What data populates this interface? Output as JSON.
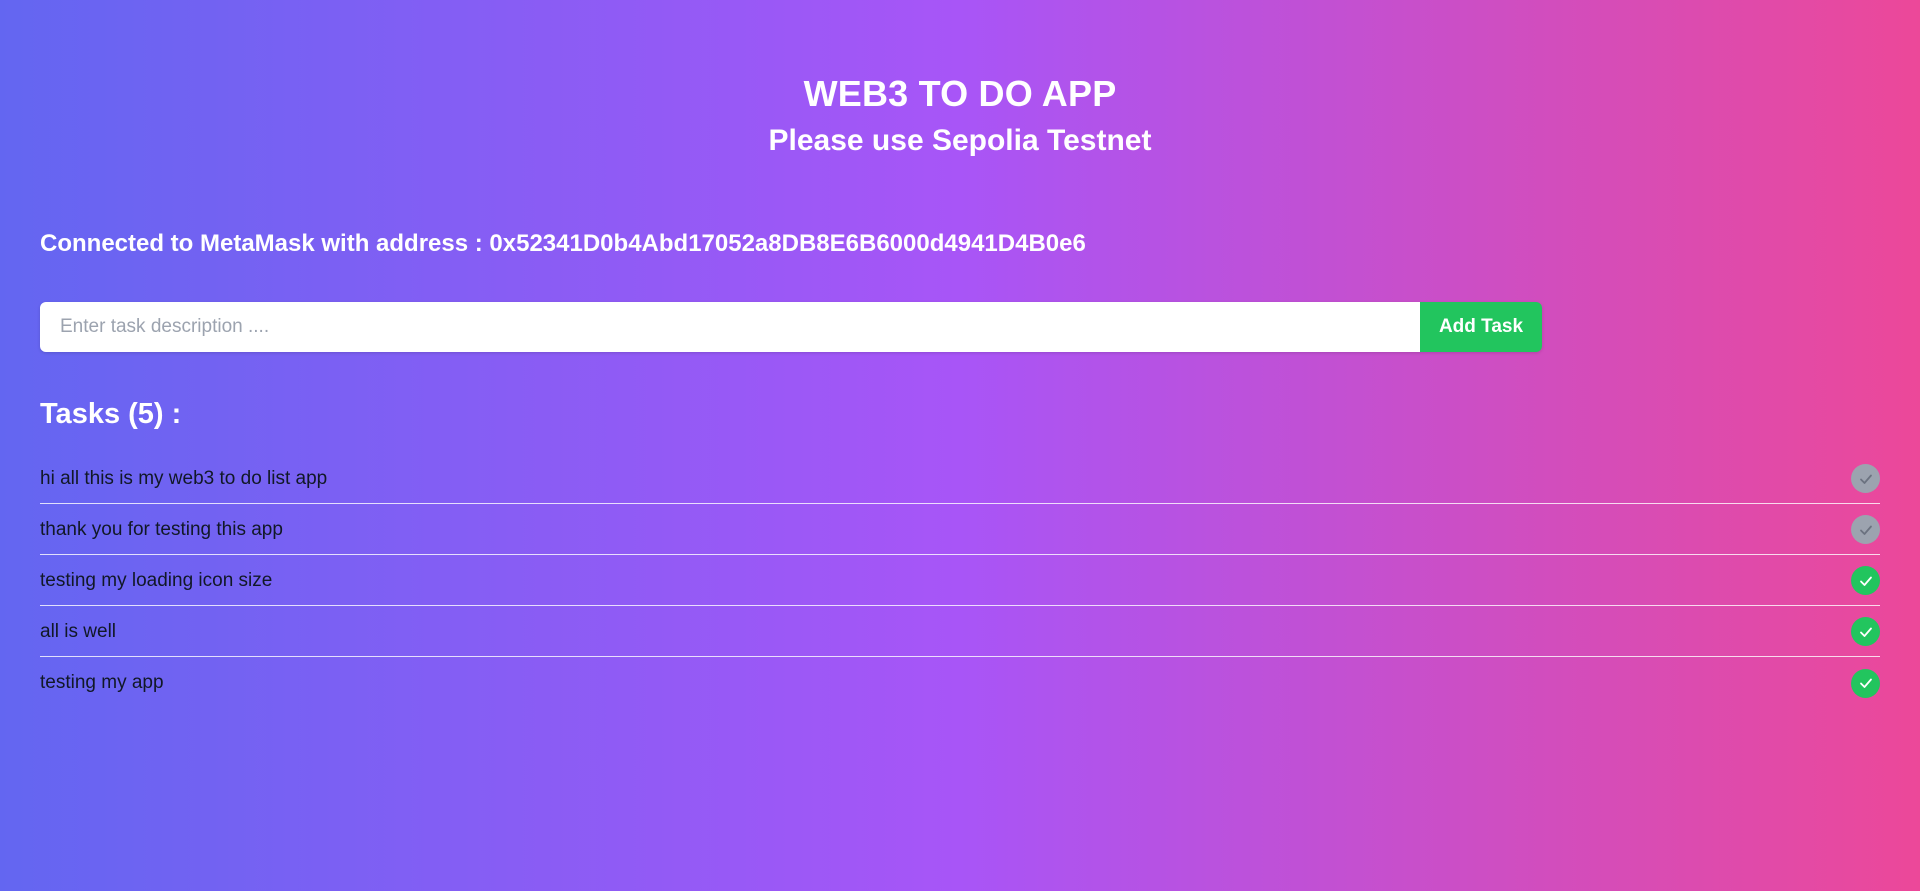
{
  "header": {
    "title": "WEB3 TO DO APP",
    "subtitle": "Please use Sepolia Testnet"
  },
  "connection": {
    "text": "Connected to MetaMask with address : 0x52341D0b4Abd17052a8DB8E6B6000d4941D4B0e6"
  },
  "task_form": {
    "input_value": "",
    "input_placeholder": "Enter task description ....",
    "add_button_label": "Add Task"
  },
  "tasks": {
    "heading": "Tasks (5) :",
    "items": [
      {
        "text": "hi all this is my web3 to do list app",
        "status_icon": "check-circle-icon",
        "status": "pending",
        "color": "#9ca3af"
      },
      {
        "text": "thank you for testing this app",
        "status_icon": "check-circle-icon",
        "status": "pending",
        "color": "#9ca3af"
      },
      {
        "text": "testing my loading icon size",
        "status_icon": "check-circle-icon",
        "status": "completed",
        "color": "#22c55e"
      },
      {
        "text": "all is well",
        "status_icon": "check-circle-icon",
        "status": "completed",
        "color": "#22c55e"
      },
      {
        "text": "testing my app",
        "status_icon": "check-circle-icon",
        "status": "completed",
        "color": "#22c55e"
      }
    ]
  },
  "colors": {
    "gradient_start": "#6366f1",
    "gradient_mid": "#a855f7",
    "gradient_end": "#ec4899",
    "accent_green": "#22c55e",
    "pending_gray": "#9ca3af"
  }
}
